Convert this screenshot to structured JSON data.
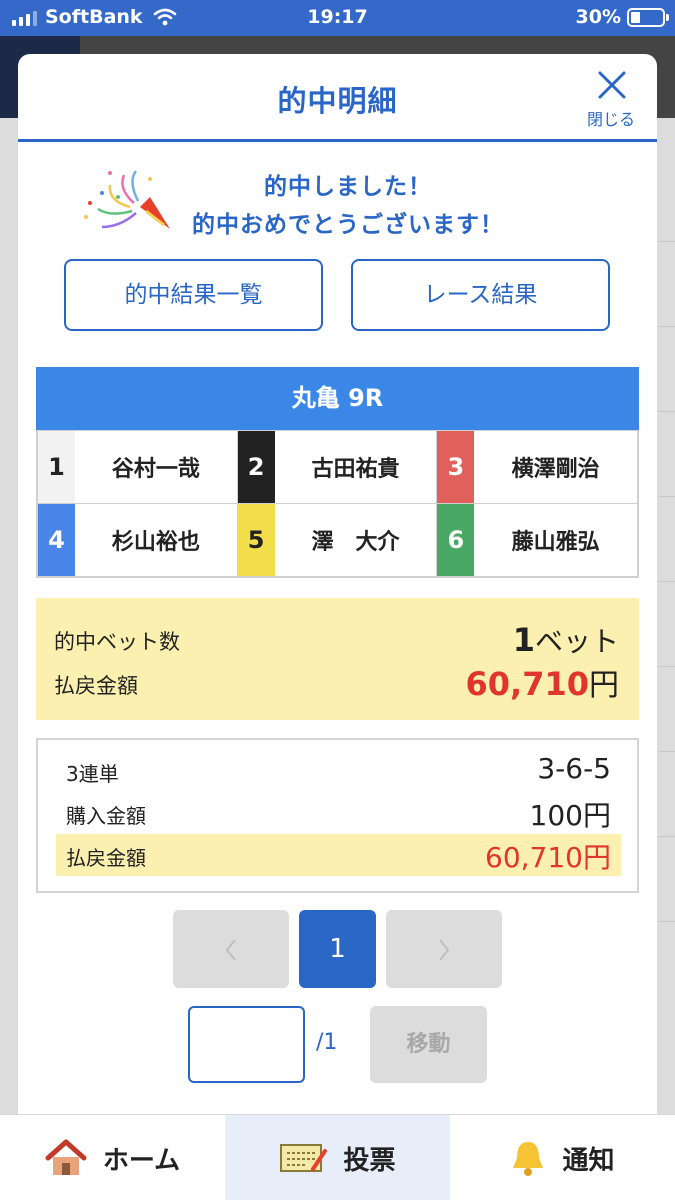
{
  "status_bar": {
    "carrier": "SoftBank",
    "time": "19:17",
    "battery": "30%",
    "battery_level": 0.3
  },
  "modal": {
    "title": "的中明細",
    "close_label": "閉じる",
    "congrats_line1": "的中しました！",
    "congrats_line2": "的中おめでとうございます！",
    "hit_results_button": "的中結果一覧",
    "race_results_button": "レース結果"
  },
  "race": {
    "title": "丸亀 9R",
    "racers": [
      {
        "lane": "1",
        "name": "谷村一哉",
        "color": "#f2f2f2"
      },
      {
        "lane": "2",
        "name": "古田祐貴",
        "color": "#222222"
      },
      {
        "lane": "3",
        "name": "横澤剛治",
        "color": "#e0605b"
      },
      {
        "lane": "4",
        "name": "杉山裕也",
        "color": "#4a86e8"
      },
      {
        "lane": "5",
        "name": "澤　大介",
        "color": "#f2de4a"
      },
      {
        "lane": "6",
        "name": "藤山雅弘",
        "color": "#4aa866"
      }
    ]
  },
  "summary": {
    "bets_label": "的中ベット数",
    "bets_value": "1",
    "bets_unit": "ベット",
    "payout_label": "払戻金額",
    "payout_value": "60,710",
    "payout_unit": "円"
  },
  "detail": {
    "bet_type": "3連単",
    "combination": "3-6-5",
    "purchase_label": "購入金額",
    "purchase_value": "100円",
    "payout_label": "払戻金額",
    "payout_value": "60,710円"
  },
  "pagination": {
    "current_page": "1",
    "total": "/1",
    "move_button": "移動",
    "page_input_value": ""
  },
  "tabbar": {
    "home": "ホーム",
    "vote": "投票",
    "notify": "通知"
  },
  "colors": {
    "accent": "#2a66c6",
    "race_header": "#3a87e8",
    "highlight": "#fbf0b0",
    "payout_red": "#e0342d"
  }
}
